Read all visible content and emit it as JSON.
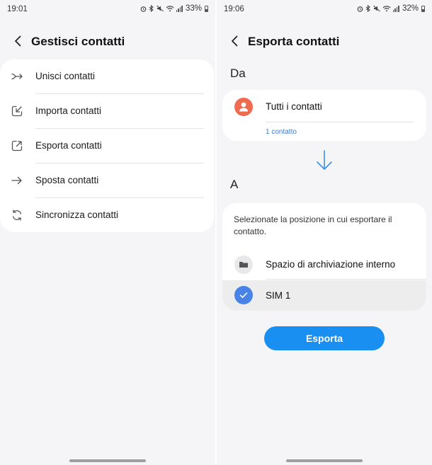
{
  "left_screen": {
    "status": {
      "time": "19:01",
      "battery": "33%"
    },
    "header": {
      "title": "Gestisci contatti"
    },
    "menu": [
      {
        "label": "Unisci contatti",
        "icon": "merge-icon"
      },
      {
        "label": "Importa contatti",
        "icon": "import-icon"
      },
      {
        "label": "Esporta contatti",
        "icon": "export-icon"
      },
      {
        "label": "Sposta contatti",
        "icon": "arrow-right-icon"
      },
      {
        "label": "Sincronizza contatti",
        "icon": "sync-icon"
      }
    ]
  },
  "right_screen": {
    "status": {
      "time": "19:06",
      "battery": "32%"
    },
    "header": {
      "title": "Esporta contatti"
    },
    "from": {
      "heading": "Da",
      "source_label": "Tutti i contatti",
      "count": "1 contatto"
    },
    "to": {
      "heading": "A",
      "description": "Selezionate la posizione in cui esportare il contatto.",
      "options": [
        {
          "label": "Spazio di archiviazione interno",
          "selected": false
        },
        {
          "label": "SIM 1",
          "selected": true
        }
      ]
    },
    "export_button": "Esporta"
  },
  "colors": {
    "accent": "#1a8ff2",
    "avatar": "#ef6b4f",
    "selected_check": "#4a83e8",
    "link": "#3a7bd5"
  }
}
